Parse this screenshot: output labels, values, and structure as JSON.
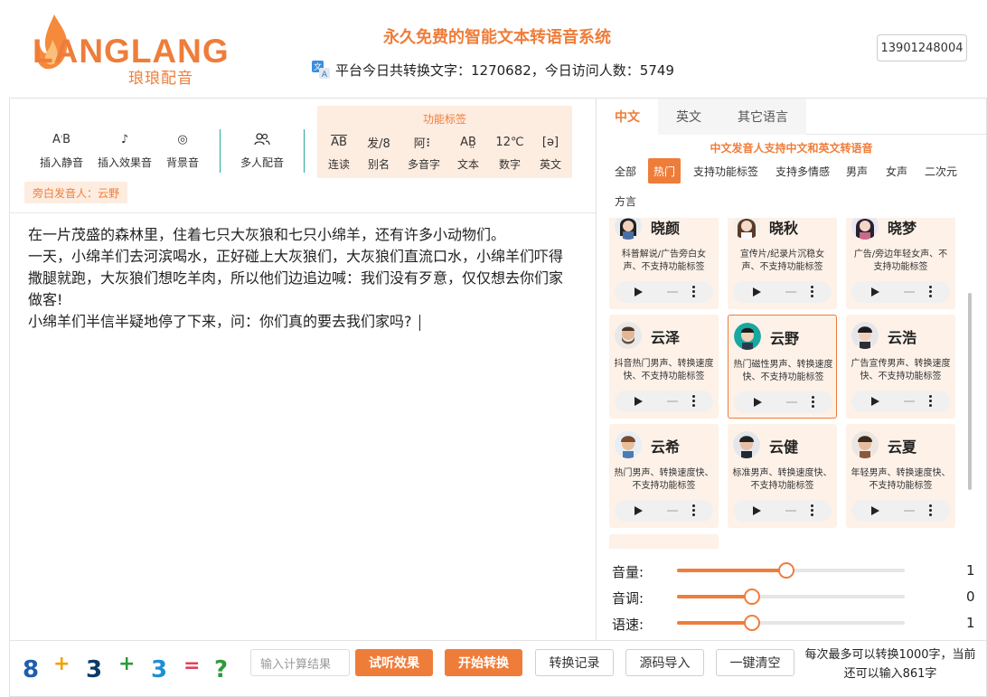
{
  "header": {
    "logo_text": "LANGLANG",
    "logo_sub": "琅琅配音",
    "site_title": "永久免费的智能文本转语音系统",
    "stats": "平台今日共转换文字：1270682，今日访问人数：5749",
    "phone": "13901248004"
  },
  "toolbar": {
    "insert_silence": "插入静音",
    "insert_effect": "插入效果音",
    "bgm": "背景音",
    "multi_voice": "多人配音",
    "func_title": "功能标签",
    "func": {
      "liandu": "连读",
      "bieming": "别名",
      "duoyinzi": "多音字",
      "wenben": "文本",
      "shuzi": "数字",
      "yingwen": "英文"
    },
    "narrator": "旁白发音人：云野"
  },
  "editor": {
    "lines": [
      "在一片茂盛的森林里，住着七只大灰狼和七只小绵羊，还有许多小动物们。",
      "一天，小绵羊们去河滨喝水，正好碰上大灰狼们，大灰狼们直流口水，小绵羊们吓得撒腿就跑，大灰狼们想吃羊肉，所以他们边追边喊：我们没有歹意，仅仅想去你们家做客!",
      "小绵羊们半信半疑地停了下来，问：你们真的要去我们家吗?"
    ]
  },
  "voice_panel": {
    "tabs": [
      "中文",
      "英文",
      "其它语言"
    ],
    "active_tab": "中文",
    "note": "中文发音人支持中文和英文转语音",
    "filters": [
      "全部",
      "热门",
      "支持功能标签",
      "支持多情感",
      "男声",
      "女声",
      "二次元",
      "方言"
    ],
    "active_filter": "热门",
    "voices": [
      {
        "name": "晓颜",
        "desc": "科普解说/广告旁白女声、不支持功能标签",
        "avatar": "woman-1"
      },
      {
        "name": "晓秋",
        "desc": "宣传片/纪录片沉稳女声、不支持功能标签",
        "avatar": "woman-2"
      },
      {
        "name": "晓梦",
        "desc": "广告/旁边年轻女声、不支持功能标签",
        "avatar": "woman-3"
      },
      {
        "name": "云泽",
        "desc": "抖音热门男声、转换速度快、不支持功能标签",
        "avatar": "man-beard"
      },
      {
        "name": "云野",
        "desc": "热门磁性男声、转换速度快、不支持功能标签",
        "avatar": "man-teal",
        "selected": true
      },
      {
        "name": "云浩",
        "desc": "广告宣传男声、转换速度快、不支持功能标签",
        "avatar": "man-dark"
      },
      {
        "name": "云希",
        "desc": "热门男声、转换速度快、不支持功能标签",
        "avatar": "man-young"
      },
      {
        "name": "云健",
        "desc": "标准男声、转换速度快、不支持功能标签",
        "avatar": "man-suit"
      },
      {
        "name": "云夏",
        "desc": "年轻男声、转换速度快、不支持功能标签",
        "avatar": "man-casual"
      }
    ],
    "sliders": [
      {
        "label": "音量:",
        "value": "1",
        "fill": 0.48
      },
      {
        "label": "音调:",
        "value": "0",
        "fill": 0.33
      },
      {
        "label": "语速:",
        "value": "1",
        "fill": 0.33
      }
    ]
  },
  "bottom": {
    "captcha": [
      "8",
      "+",
      "3",
      "+",
      "3",
      "=",
      "?"
    ],
    "captcha_colors": [
      "#1e5fa8",
      "#f2a100",
      "#0d3b66",
      "#2e9b3a",
      "#1e8fd6",
      "#e0415a",
      "#2e9b3a"
    ],
    "calc_placeholder": "输入计算结果",
    "try_btn": "试听效果",
    "start_btn": "开始转换",
    "history_btn": "转换记录",
    "source_btn": "源码导入",
    "clear_btn": "一键清空",
    "limit_note": "每次最多可以转换1000字，当前还可以输入861字"
  },
  "colors": {
    "accent": "#ef7d3a",
    "accent_light": "#fdece0",
    "divider": "#2aa89a"
  }
}
